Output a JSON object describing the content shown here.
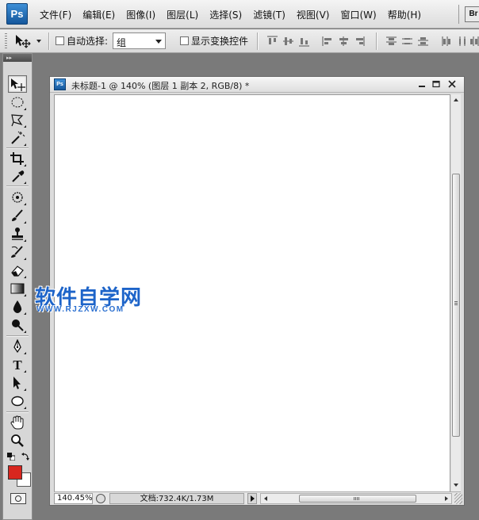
{
  "app": {
    "logo_text": "Ps"
  },
  "menu": {
    "items": [
      "文件(F)",
      "编辑(E)",
      "图像(I)",
      "图层(L)",
      "选择(S)",
      "滤镜(T)",
      "视图(V)",
      "窗口(W)",
      "帮助(H)"
    ],
    "bridge_label": "Br"
  },
  "options": {
    "auto_select_label": "自动选择:",
    "auto_select_checked": false,
    "auto_select_value": "组",
    "show_transform_label": "显示变换控件",
    "show_transform_checked": false
  },
  "toolbox": {
    "tools": [
      "move-tool",
      "marquee-tool",
      "lasso-tool",
      "magic-wand-tool",
      "crop-tool",
      "eyedropper-tool",
      "healing-brush-tool",
      "brush-tool",
      "clone-stamp-tool",
      "history-brush-tool",
      "eraser-tool",
      "gradient-tool",
      "blur-tool",
      "dodge-tool",
      "pen-tool",
      "type-tool",
      "path-selection-tool",
      "shape-tool",
      "hand-tool",
      "zoom-tool"
    ],
    "type_tool_glyph": "T",
    "foreground_color": "#d8261f",
    "background_color": "#ffffff"
  },
  "document": {
    "title": "未标题-1 @ 140% (图层 1 副本 2, RGB/8) *",
    "zoom": "140.45%",
    "doc_info": "文档:732.4K/1.73M",
    "canvas_color": "#ffffff"
  },
  "watermark": {
    "main": "软件自学网",
    "sub": "WWW.RJZXW.COM"
  }
}
